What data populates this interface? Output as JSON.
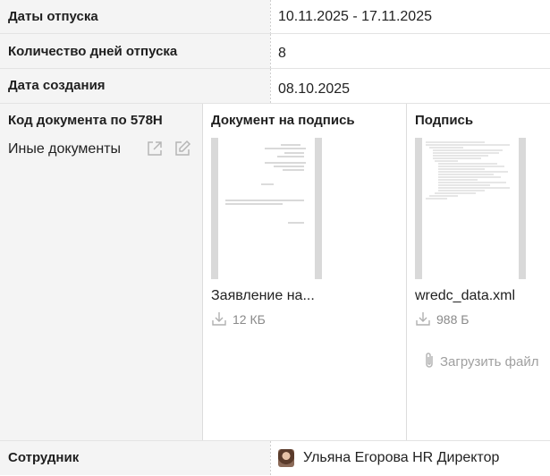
{
  "fields": {
    "vacation_dates": {
      "label": "Даты отпуска",
      "value": "10.11.2025 - 17.11.2025"
    },
    "vacation_days": {
      "label": "Количество дней отпуска",
      "value": "8"
    },
    "created_date": {
      "label": "Дата создания",
      "value": "08.10.2025"
    }
  },
  "documents": {
    "doc_code": {
      "title": "Код документа по 578Н",
      "value": "Иные документы"
    },
    "for_signature": {
      "title": "Документ на подпись",
      "file_name": "Заявление на...",
      "file_size": "12 КБ"
    },
    "signature": {
      "title": "Подпись",
      "file_name": "wredc_data.xml",
      "file_size": "988 Б",
      "upload_label": "Загрузить файл"
    }
  },
  "employee": {
    "label": "Сотрудник",
    "value": "Ульяна Егорова HR Директор"
  },
  "icons": [
    "external-link-icon",
    "edit-icon",
    "download-icon",
    "paperclip-icon"
  ]
}
